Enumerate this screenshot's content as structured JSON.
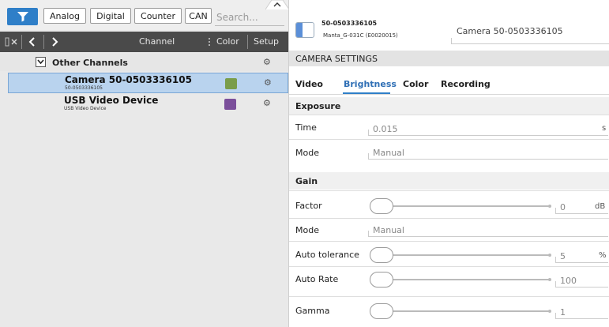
{
  "filter": {
    "buttons": [
      "Analog",
      "Digital",
      "Counter",
      "CAN"
    ],
    "search_placeholder": "Search..."
  },
  "channel_header": {
    "channel_label": "Channel",
    "color_label": "Color",
    "setup_label": "Setup"
  },
  "group": {
    "label": "Other Channels"
  },
  "channels": [
    {
      "name": "Camera 50-0503336105",
      "sub": "50-0503336105",
      "color": "#7a9d4a",
      "selected": true
    },
    {
      "name": "USB Video Device",
      "sub": "USB Video Device",
      "color": "#7b4f9b",
      "selected": false
    }
  ],
  "camera": {
    "id": "50-0503336105",
    "model": "Manta_G-031C (E0020015)",
    "title": "Camera 50-0503336105"
  },
  "settings": {
    "section_title": "CAMERA SETTINGS",
    "tabs": [
      "Video",
      "Brightness",
      "Color",
      "Recording"
    ],
    "active_tab": "Brightness",
    "exposure": {
      "header": "Exposure",
      "time_label": "Time",
      "time_value": "0.015",
      "time_unit": "s",
      "mode_label": "Mode",
      "mode_value": "Manual"
    },
    "gain": {
      "header": "Gain",
      "factor_label": "Factor",
      "factor_value": "0",
      "factor_unit": "dB",
      "mode_label": "Mode",
      "mode_value": "Manual",
      "auto_tolerance_label": "Auto tolerance",
      "auto_tolerance_value": "5",
      "auto_tolerance_unit": "%",
      "auto_rate_label": "Auto Rate",
      "auto_rate_value": "100"
    },
    "gamma": {
      "label": "Gamma",
      "value": "1"
    }
  },
  "colors": {
    "accent": "#2f7fc8",
    "header_bg": "#4a4a4a",
    "selected_row": "#b9d3ee"
  }
}
